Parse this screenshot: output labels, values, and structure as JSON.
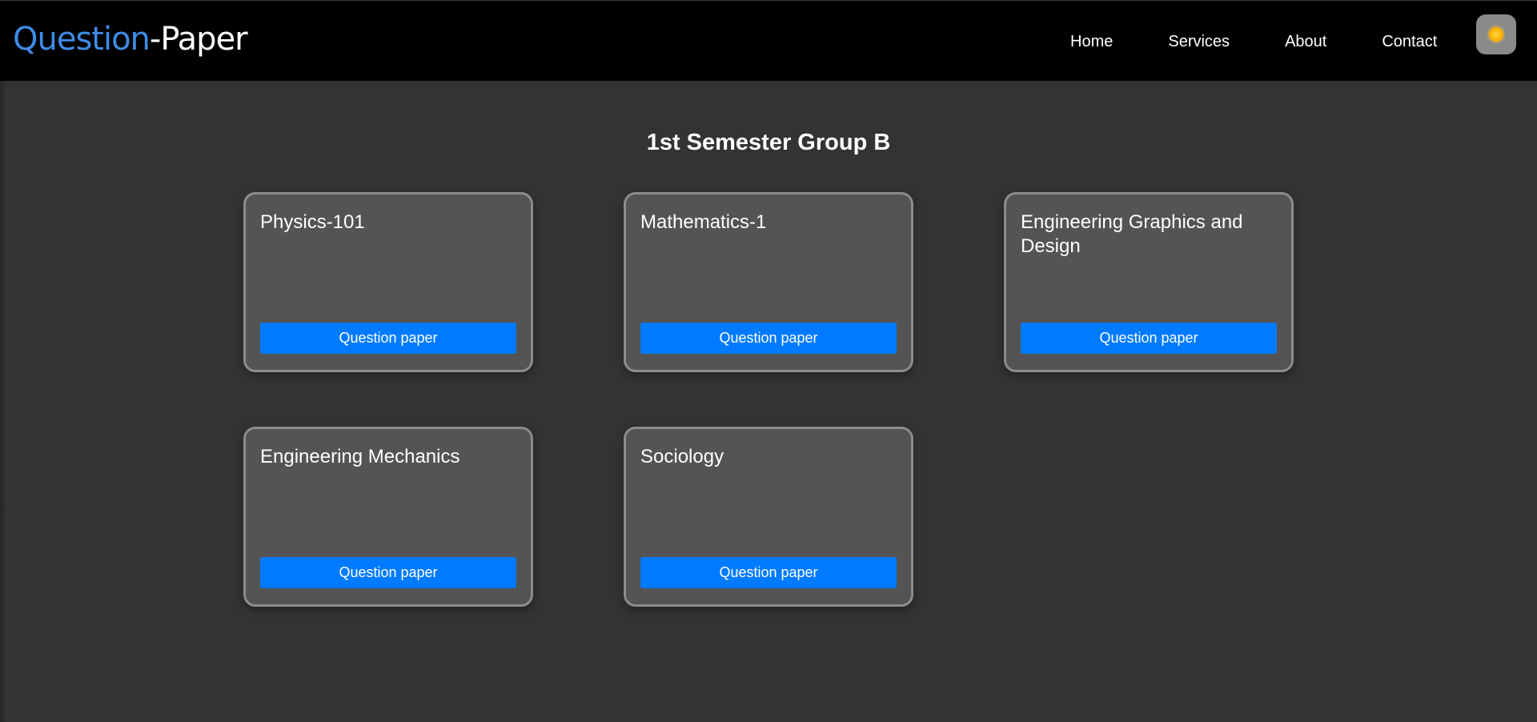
{
  "brand": {
    "part1": "Question",
    "part2": "-Paper",
    "part1_color": "#3f8be6",
    "part2_color": "#ffffff"
  },
  "nav": {
    "items": [
      {
        "label": "Home"
      },
      {
        "label": "Services"
      },
      {
        "label": "About"
      },
      {
        "label": "Contact"
      }
    ]
  },
  "theme_toggle": {
    "icon": "sun-icon"
  },
  "main": {
    "title": "1st Semester Group B",
    "cards": [
      {
        "title": "Physics-101",
        "button": "Question paper"
      },
      {
        "title": "Mathematics-1",
        "button": "Question paper"
      },
      {
        "title": "Engineering Graphics and Design",
        "button": "Question paper"
      },
      {
        "title": "Engineering Mechanics",
        "button": "Question paper"
      },
      {
        "title": "Sociology",
        "button": "Question paper"
      }
    ]
  },
  "colors": {
    "background": "#333333",
    "navbar": "#000000",
    "card": "#545454",
    "card_border": "#8c8c8c",
    "button": "#007bff"
  }
}
